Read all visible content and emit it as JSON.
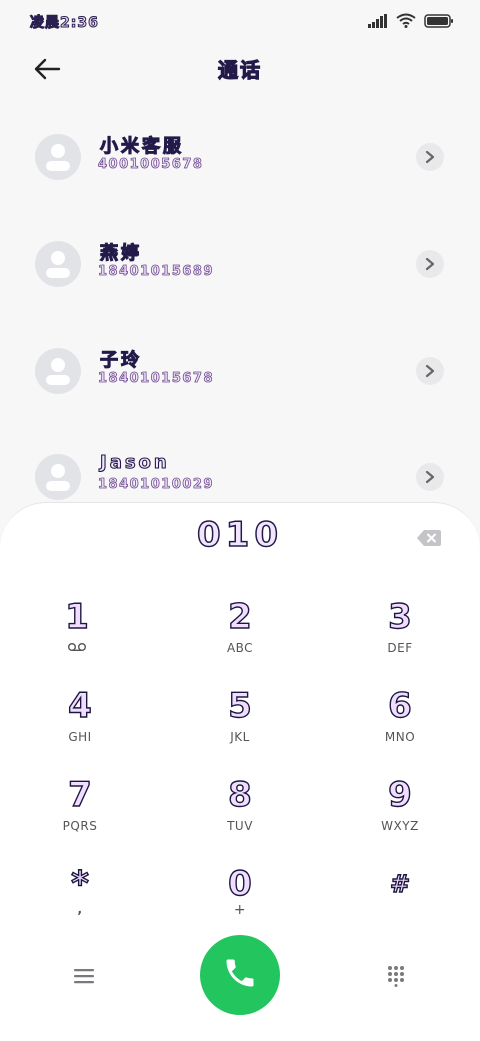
{
  "status_bar": {
    "time": "凌晨2:36"
  },
  "header": {
    "title": "通话"
  },
  "contacts": [
    {
      "name": "小米客服",
      "number": "4001005678"
    },
    {
      "name": "燕婷",
      "number": "18401015689"
    },
    {
      "name": "子玲",
      "number": "18401015678"
    },
    {
      "name": "Jason",
      "number": "18401010029"
    }
  ],
  "dialer": {
    "input": "010",
    "keys": [
      {
        "digit": "1",
        "letters": ""
      },
      {
        "digit": "2",
        "letters": "ABC"
      },
      {
        "digit": "3",
        "letters": "DEF"
      },
      {
        "digit": "4",
        "letters": "GHI"
      },
      {
        "digit": "5",
        "letters": "JKL"
      },
      {
        "digit": "6",
        "letters": "MNO"
      },
      {
        "digit": "7",
        "letters": "PQRS"
      },
      {
        "digit": "8",
        "letters": "TUV"
      },
      {
        "digit": "9",
        "letters": "WXYZ"
      },
      {
        "digit": "*",
        "letters": ","
      },
      {
        "digit": "0",
        "letters": "+"
      },
      {
        "digit": "#",
        "letters": ""
      }
    ]
  },
  "icons": {
    "call": "phone-icon",
    "menu": "menu-icon",
    "dialpad_toggle": "dialpad-icon",
    "delete": "backspace-icon",
    "voicemail": "voicemail-icon",
    "back": "back-arrow-icon",
    "contact_avatar": "avatar-icon",
    "contact_detail": "chevron-right-icon"
  },
  "colors": {
    "call_button": "#22c55e",
    "avatar_bg": "#e1e3e7"
  }
}
